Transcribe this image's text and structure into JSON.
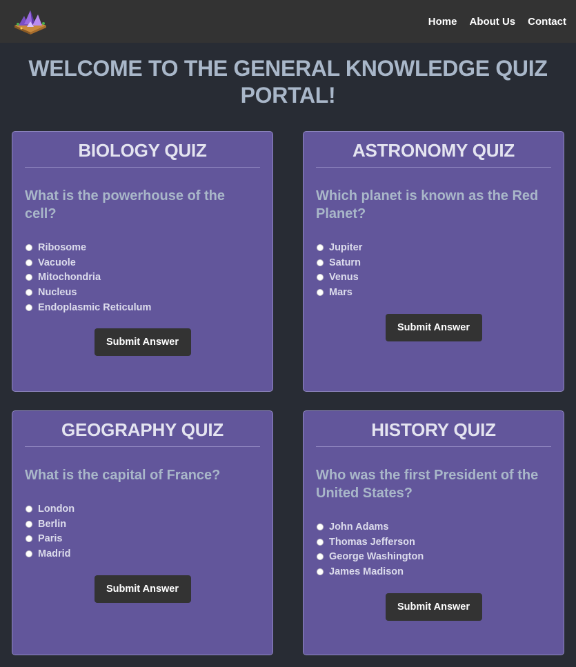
{
  "nav": {
    "links": [
      "Home",
      "About Us",
      "Contact"
    ]
  },
  "page": {
    "title": "WELCOME TO THE GENERAL KNOWLEDGE QUIZ PORTAL!"
  },
  "quizzes": [
    {
      "title": "BIOLOGY QUIZ",
      "question": "What is the powerhouse of the cell?",
      "options": [
        "Ribosome",
        "Vacuole",
        "Mitochondria",
        "Nucleus",
        "Endoplasmic Reticulum"
      ],
      "button": "Submit Answer"
    },
    {
      "title": "ASTRONOMY QUIZ",
      "question": "Which planet is known as the Red Planet?",
      "options": [
        "Jupiter",
        "Saturn",
        "Venus",
        "Mars"
      ],
      "button": "Submit Answer"
    },
    {
      "title": "GEOGRAPHY QUIZ",
      "question": "What is the capital of France?",
      "options": [
        "London",
        "Berlin",
        "Paris",
        "Madrid"
      ],
      "button": "Submit Answer"
    },
    {
      "title": "HISTORY QUIZ",
      "question": "Who was the first President of the United States?",
      "options": [
        "John Adams",
        "Thomas Jefferson",
        "George Washington",
        "James Madison"
      ],
      "button": "Submit Answer"
    }
  ]
}
